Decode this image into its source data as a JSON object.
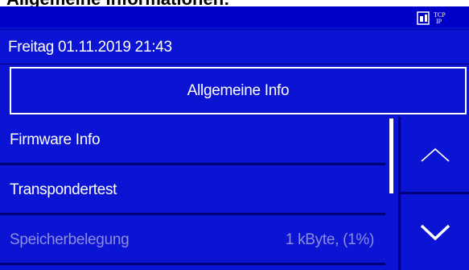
{
  "heading": "Allgemeine Informationen:",
  "statusbar": {
    "icon": "tcp-ip-network-icon",
    "icon_text_top": "TCP",
    "icon_text_bottom": "IP"
  },
  "datetime": "Freitag 01.11.2019 21:43",
  "screen_title": "Allgemeine Info",
  "menu_items": [
    {
      "label": "Firmware Info",
      "value": "",
      "enabled": true
    },
    {
      "label": "Transpondertest",
      "value": "",
      "enabled": true
    },
    {
      "label": "Speicherbelegung",
      "value": "1 kByte, (1%)",
      "enabled": false
    }
  ],
  "scroll": {
    "position_fraction": 0.0,
    "visible_fraction": 0.5
  },
  "colors": {
    "background": "#0a14d2",
    "divider": "#00007a",
    "text": "#ffffff",
    "disabled_text": "#8c8ce0"
  }
}
